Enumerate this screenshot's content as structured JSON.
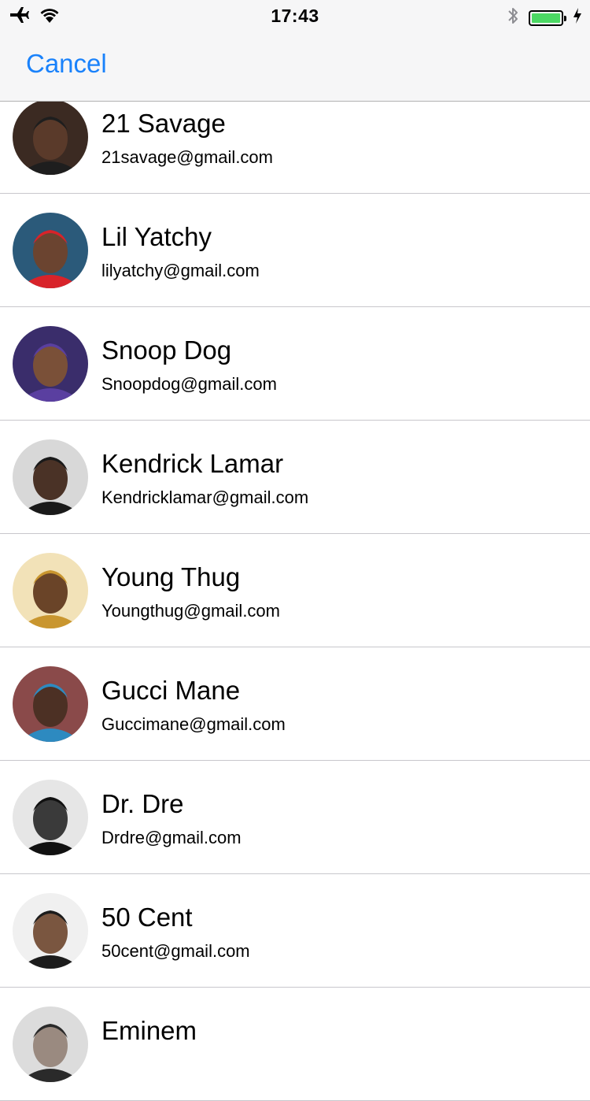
{
  "status_bar": {
    "time": "17:43",
    "battery_level": 1.0,
    "icons": [
      "airplane-mode-icon",
      "wifi-icon",
      "bluetooth-icon",
      "battery-icon",
      "charging-icon"
    ],
    "battery_color": "#4cd964"
  },
  "nav": {
    "cancel_label": "Cancel",
    "accent_color": "#1a82fb"
  },
  "contacts": [
    {
      "name": "21 Savage",
      "email": "21savage@gmail.com",
      "avatar_bg": "#3b2a22",
      "avatar_skin": "#5a3a2a",
      "avatar_accent": "#1e1e1e"
    },
    {
      "name": "Lil Yatchy",
      "email": "lilyatchy@gmail.com",
      "avatar_bg": "#2b5a7a",
      "avatar_skin": "#6b4430",
      "avatar_accent": "#d8232a"
    },
    {
      "name": "Snoop Dog",
      "email": "Snoopdog@gmail.com",
      "avatar_bg": "#3a2d6b",
      "avatar_skin": "#7a5038",
      "avatar_accent": "#5a3fa0"
    },
    {
      "name": "Kendrick Lamar",
      "email": "Kendricklamar@gmail.com",
      "avatar_bg": "#d8d8d8",
      "avatar_skin": "#4a3226",
      "avatar_accent": "#1a1a1a"
    },
    {
      "name": "Young Thug",
      "email": "Youngthug@gmail.com",
      "avatar_bg": "#f2e2b8",
      "avatar_skin": "#6a4428",
      "avatar_accent": "#c9962f"
    },
    {
      "name": "Gucci Mane",
      "email": "Guccimane@gmail.com",
      "avatar_bg": "#8a4a4a",
      "avatar_skin": "#4c3024",
      "avatar_accent": "#2d8ac0"
    },
    {
      "name": "Dr. Dre",
      "email": "Drdre@gmail.com",
      "avatar_bg": "#e6e6e6",
      "avatar_skin": "#3a3a3a",
      "avatar_accent": "#111111"
    },
    {
      "name": "50 Cent",
      "email": "50cent@gmail.com",
      "avatar_bg": "#f0f0f0",
      "avatar_skin": "#7a5640",
      "avatar_accent": "#1c1c1c"
    },
    {
      "name": "Eminem",
      "email": "",
      "avatar_bg": "#dcdcdc",
      "avatar_skin": "#9a8a80",
      "avatar_accent": "#2a2a2a"
    }
  ]
}
